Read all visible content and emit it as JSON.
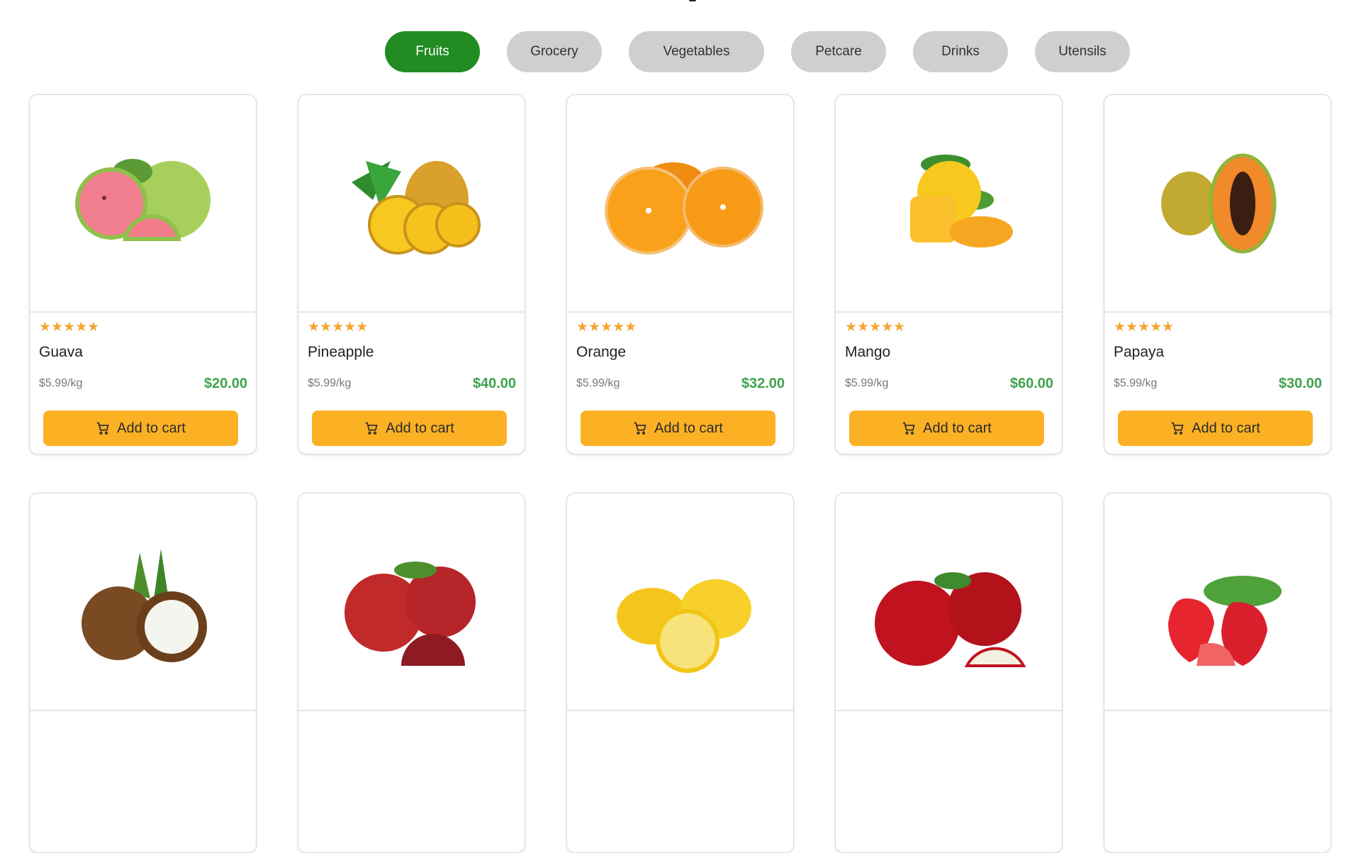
{
  "tabs": [
    {
      "label": "Fruits",
      "active": true
    },
    {
      "label": "Grocery",
      "active": false
    },
    {
      "label": "Vegetables",
      "active": false
    },
    {
      "label": "Petcare",
      "active": false
    },
    {
      "label": "Drinks",
      "active": false
    },
    {
      "label": "Utensils",
      "active": false
    }
  ],
  "products": [
    {
      "name": "Guava",
      "unit_price": "$5.99/kg",
      "price": "$20.00",
      "rating": 5,
      "stars": "★★★★★",
      "add_label": "Add to cart",
      "icon": "guava-image"
    },
    {
      "name": "Pineapple",
      "unit_price": "$5.99/kg",
      "price": "$40.00",
      "rating": 5,
      "stars": "★★★★★",
      "add_label": "Add to cart",
      "icon": "pineapple-image"
    },
    {
      "name": "Orange",
      "unit_price": "$5.99/kg",
      "price": "$32.00",
      "rating": 5,
      "stars": "★★★★★",
      "add_label": "Add to cart",
      "icon": "orange-image"
    },
    {
      "name": "Mango",
      "unit_price": "$5.99/kg",
      "price": "$60.00",
      "rating": 5,
      "stars": "★★★★★",
      "add_label": "Add to cart",
      "icon": "mango-image"
    },
    {
      "name": "Papaya",
      "unit_price": "$5.99/kg",
      "price": "$30.00",
      "rating": 5,
      "stars": "★★★★★",
      "add_label": "Add to cart",
      "icon": "papaya-image"
    },
    {
      "icon": "coconut-image"
    },
    {
      "icon": "pomegranate-image"
    },
    {
      "icon": "lemon-image"
    },
    {
      "icon": "apple-image"
    },
    {
      "icon": "strawberry-image"
    }
  ],
  "colors": {
    "active_tab": "#228b22",
    "inactive_tab": "#cfcfcf",
    "price": "#3fa34d",
    "stars": "#f4a532",
    "cart_button": "#fcb124"
  }
}
